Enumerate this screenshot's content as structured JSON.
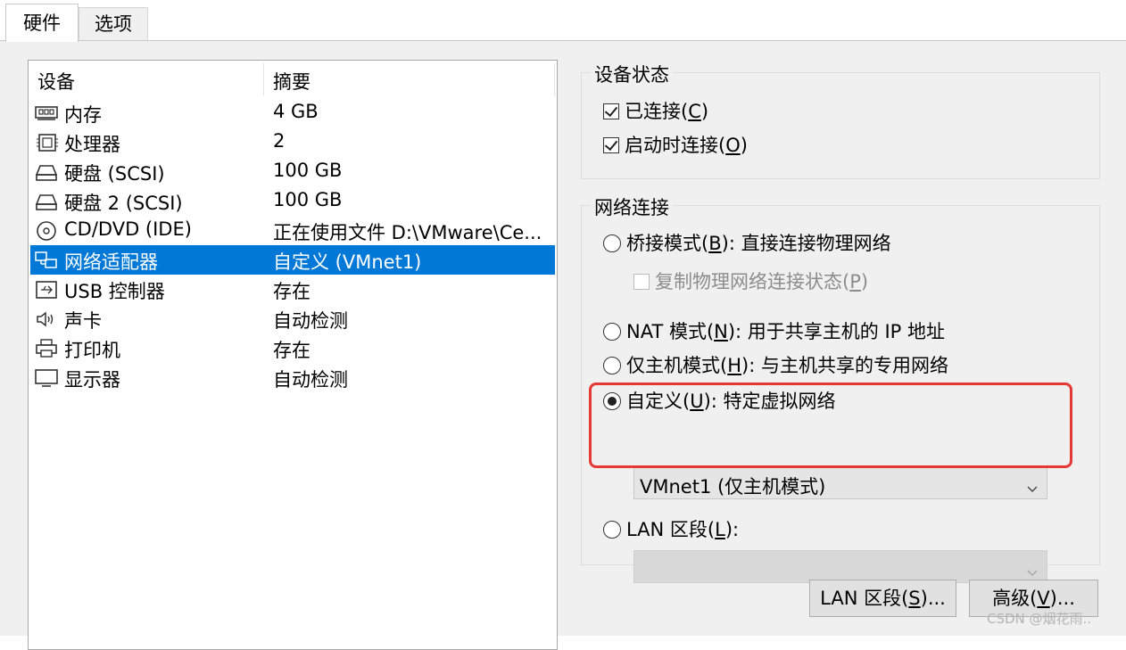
{
  "tabs": [
    "硬件",
    "选项"
  ],
  "device_list": {
    "headers": [
      "设备",
      "摘要"
    ],
    "rows": [
      {
        "icon": "memory-icon",
        "name": "内存",
        "summary": "4 GB"
      },
      {
        "icon": "processor-icon",
        "name": "处理器",
        "summary": "2"
      },
      {
        "icon": "hard-disk-icon",
        "name": "硬盘 (SCSI)",
        "summary": "100 GB"
      },
      {
        "icon": "hard-disk-icon",
        "name": "硬盘 2 (SCSI)",
        "summary": "100 GB"
      },
      {
        "icon": "cd-dvd-icon",
        "name": "CD/DVD (IDE)",
        "summary": "正在使用文件 D:\\VMware\\Ce..."
      },
      {
        "icon": "network-adapter-icon",
        "name": "网络适配器",
        "summary": "自定义 (VMnet1)",
        "selected": true
      },
      {
        "icon": "usb-icon",
        "name": "USB 控制器",
        "summary": "存在"
      },
      {
        "icon": "sound-icon",
        "name": "声卡",
        "summary": "自动检测"
      },
      {
        "icon": "printer-icon",
        "name": "打印机",
        "summary": "存在"
      },
      {
        "icon": "display-icon",
        "name": "显示器",
        "summary": "自动检测"
      }
    ]
  },
  "device_status": {
    "legend": "设备状态",
    "connected": {
      "label": "已连接(",
      "key": "C",
      "end": ")",
      "checked": true
    },
    "connect_at_power_on": {
      "label": "启动时连接(",
      "key": "O",
      "end": ")",
      "checked": true
    }
  },
  "network": {
    "legend": "网络连接",
    "bridged": {
      "label": "桥接模式(",
      "key": "B",
      "end": "): 直接连接物理网络",
      "selected": false
    },
    "replicate": {
      "label": "复制物理网络连接状态(",
      "key": "P",
      "end": ")",
      "checked": false,
      "disabled": true
    },
    "nat": {
      "label": "NAT 模式(",
      "key": "N",
      "end": "): 用于共享主机的 IP 地址",
      "selected": false
    },
    "host_only": {
      "label": "仅主机模式(",
      "key": "H",
      "end": "): 与主机共享的专用网络",
      "selected": false
    },
    "custom": {
      "label": "自定义(",
      "key": "U",
      "end": "): 特定虚拟网络",
      "selected": true
    },
    "custom_select_value": "VMnet1 (仅主机模式)",
    "lan_segment": {
      "label": "LAN 区段(",
      "key": "L",
      "end": "):",
      "selected": false
    },
    "lan_select_value": ""
  },
  "buttons": {
    "lan_segments": {
      "label": "LAN 区段(",
      "key": "S",
      "end": ")..."
    },
    "advanced": {
      "label": "高级(",
      "key": "V",
      "end": ")..."
    }
  },
  "highlight_color": "#e53935",
  "selection_color": "#0078d7",
  "watermark": "CSDN @烟花雨.."
}
